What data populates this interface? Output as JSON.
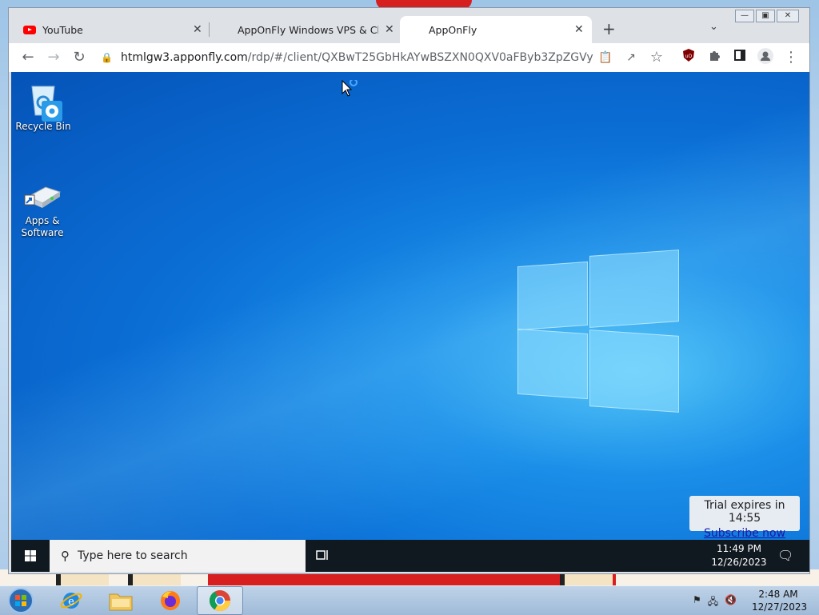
{
  "browser": {
    "tabs": [
      {
        "title": "YouTube",
        "icon": "youtube-icon"
      },
      {
        "title": "AppOnFly Windows VPS & Cloud",
        "icon": ""
      },
      {
        "title": "AppOnFly",
        "icon": "",
        "active": true
      }
    ],
    "tab_close_glyph": "✕",
    "new_tab_glyph": "+",
    "url": {
      "host": "htmlgw3.apponfly.com",
      "path": "/rdp/#/client/QXBwT25GbHkAYwBSZXN0QXV0aFByb3ZpZGVy"
    }
  },
  "remote": {
    "desktop_icons": [
      {
        "label": "Recycle Bin",
        "icon": "recycle-bin-icon"
      },
      {
        "label": "Apps & Software",
        "icon": "apps-software-icon"
      }
    ],
    "trial": {
      "text": "Trial expires in 14:55",
      "link": "Subscribe now"
    },
    "taskbar": {
      "search_placeholder": "Type here to search",
      "time": "11:49 PM",
      "date": "12/26/2023"
    }
  },
  "host": {
    "taskbar_apps": [
      "start-orb",
      "internet-explorer",
      "file-explorer",
      "firefox",
      "chrome"
    ],
    "time": "2:48 AM",
    "date": "12/27/2023"
  },
  "colors": {
    "tab_strip": "#dee1e6",
    "desktop_blue": "#0b6fd6",
    "trial_link": "#1a1aa6"
  }
}
